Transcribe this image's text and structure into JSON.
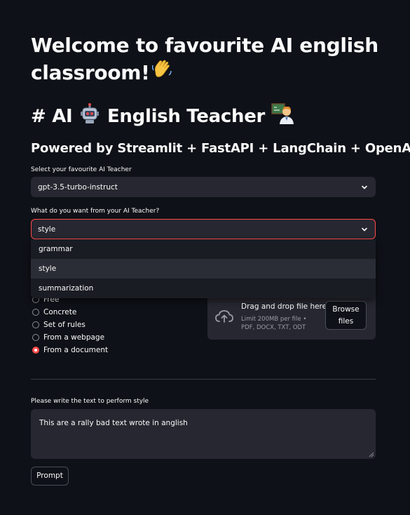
{
  "header": {
    "welcome_line1": "Welcome to favourite AI english",
    "welcome_line2": "classroom!",
    "title_prefix": "# AI",
    "title_suffix": "English Teacher",
    "subtitle": "Powered by Streamlit + FastAPI + LangChain + OpenAI"
  },
  "teacher_select": {
    "label": "Select your favourite AI Teacher",
    "value": "gpt-3.5-turbo-instruct"
  },
  "task_select": {
    "label": "What do you want from your AI Teacher?",
    "value": "style",
    "options": [
      "grammar",
      "style",
      "summarization"
    ]
  },
  "context_radio": {
    "options": [
      {
        "label": "Free",
        "selected": false
      },
      {
        "label": "Concrete",
        "selected": false
      },
      {
        "label": "Set of rules",
        "selected": false
      },
      {
        "label": "From a webpage",
        "selected": false
      },
      {
        "label": "From a document",
        "selected": true
      }
    ]
  },
  "uploader": {
    "drag_text": "Drag and drop file here",
    "limit_text": "Limit 200MB per file • PDF, DOCX, TXT, ODT",
    "browse_label_1": "Browse",
    "browse_label_2": "files",
    "icon": "cloud-upload-icon"
  },
  "text_input": {
    "label": "Please write the text to perform style",
    "value": "This are a rally bad text wrote in anglish"
  },
  "actions": {
    "prompt_label": "Prompt"
  },
  "colors": {
    "background": "#0e1117",
    "widget": "#262730",
    "accent": "#ff4b4b",
    "text": "#fafafa"
  }
}
